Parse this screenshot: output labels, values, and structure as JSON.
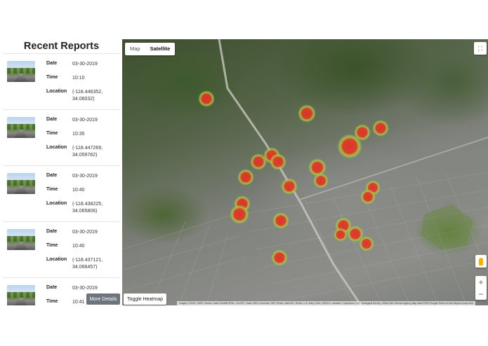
{
  "sidebar": {
    "title": "Recent Reports",
    "labels": {
      "date": "Date",
      "time": "Time",
      "location": "Location"
    },
    "reports": [
      {
        "date": "03-30-2019",
        "time": "10:10",
        "location_line1": "(-118.446352,",
        "location_line2": "34.06032)"
      },
      {
        "date": "03-30-2019",
        "time": "10:35",
        "location_line1": "(-118.447269,",
        "location_line2": "34.059782)"
      },
      {
        "date": "03-30-2019",
        "time": "10:40",
        "location_line1": "(-118.438225,",
        "location_line2": "34.065806)"
      },
      {
        "date": "03-30-2019",
        "time": "10:40",
        "location_line1": "(-118.437121,",
        "location_line2": "34.066457)"
      },
      {
        "date": "03-30-2019",
        "time": "10:41",
        "location_line1": "",
        "location_line2": ""
      }
    ],
    "more_details_label": "More Details"
  },
  "map": {
    "type_buttons": {
      "map": "Map",
      "satellite": "Satellite"
    },
    "active_type": "satellite",
    "fullscreen_icon": "fullscreen-icon",
    "pegman_icon": "pegman-icon",
    "zoom_in": "+",
    "zoom_out": "−",
    "attribution": "Imagery ©2019, CNES / Airbus, Data CSUMB SFML, CA OPC, Data LDEO-Columbia, NSF, NOAA, Data SIO, NOAA, U.S. Navy, NGA, GEBCO, Landsat / Copernicus, U.S. Geological Survey, USDA Farm Service Agency Map data ©2019 Google   Terms of Use   Report a map error",
    "toggle_heatmap_label": "Toggle Heatmap",
    "heat_color_core": "#e0312a",
    "heat_color_edge": "#7cd04a"
  }
}
